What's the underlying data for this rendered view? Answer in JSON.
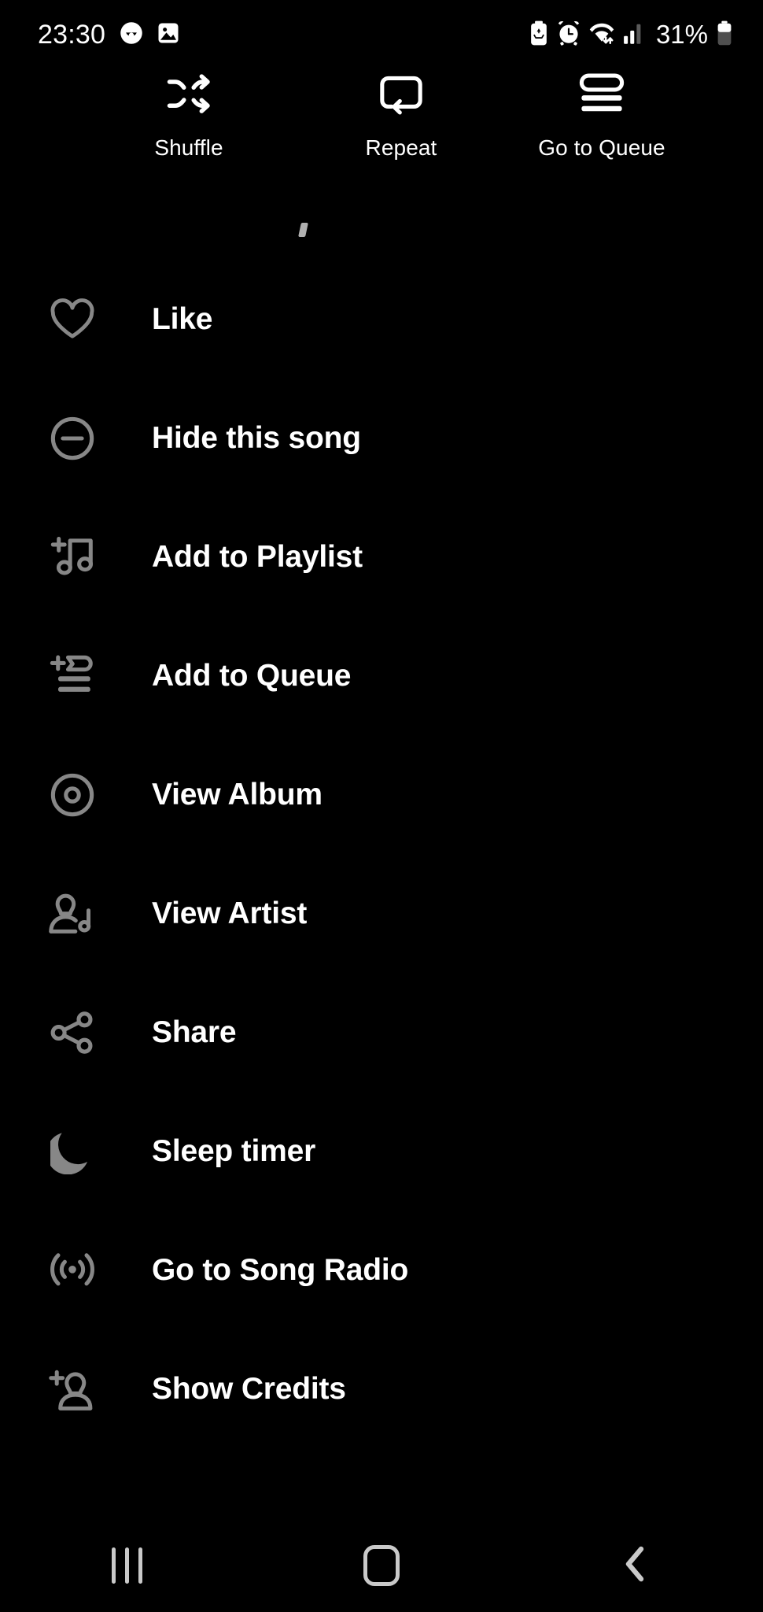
{
  "status_bar": {
    "time": "23:30",
    "battery_percent": "31%",
    "left_icons": [
      {
        "name": "smiley-face-icon"
      },
      {
        "name": "image-gallery-icon"
      }
    ],
    "right_icons": [
      {
        "name": "battery-saver-icon"
      },
      {
        "name": "alarm-clock-icon"
      },
      {
        "name": "wifi-icon"
      },
      {
        "name": "cellular-signal-icon"
      },
      {
        "name": "battery-icon"
      }
    ]
  },
  "top_actions": [
    {
      "label": "Shuffle",
      "icon": "shuffle-icon"
    },
    {
      "label": "Repeat",
      "icon": "repeat-icon"
    },
    {
      "label": "Go to Queue",
      "icon": "queue-icon"
    }
  ],
  "menu": {
    "items": [
      {
        "label": "Like",
        "icon": "heart-icon"
      },
      {
        "label": "Hide this song",
        "icon": "minus-circle-icon"
      },
      {
        "label": "Add to Playlist",
        "icon": "add-music-note-icon"
      },
      {
        "label": "Add to Queue",
        "icon": "add-to-queue-icon"
      },
      {
        "label": "View Album",
        "icon": "album-disc-icon"
      },
      {
        "label": "View Artist",
        "icon": "artist-person-note-icon"
      },
      {
        "label": "Share",
        "icon": "share-icon"
      },
      {
        "label": "Sleep timer",
        "icon": "moon-icon"
      },
      {
        "label": "Go to Song Radio",
        "icon": "radio-broadcast-icon"
      },
      {
        "label": "Show Credits",
        "icon": "add-person-icon"
      }
    ]
  },
  "nav_bar": {
    "recents": "recents-icon",
    "home": "home-icon",
    "back": "back-icon"
  },
  "colors": {
    "background": "#000000",
    "text_primary": "#ffffff",
    "icon_muted": "#878787",
    "nav_icon": "#c9c9c9"
  }
}
